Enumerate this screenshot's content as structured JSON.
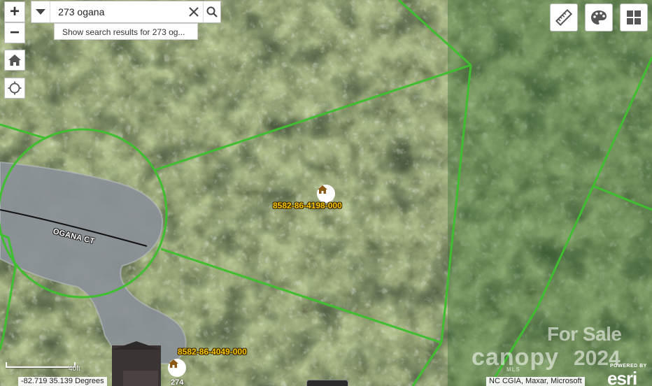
{
  "map": {
    "labels": {
      "parcel_main": "8582-86-4198-000",
      "parcel_south": "8582-86-4049-000",
      "house_number": "274",
      "street": "OGANA CT"
    },
    "colors": {
      "parcel_boundary": "#3fbf2f",
      "road_line": "#111111",
      "parcel_label": "#f6c400"
    }
  },
  "controls": {
    "zoom_in": "+",
    "zoom_out": "−",
    "home_icon": "home-icon",
    "locate_icon": "locate-icon"
  },
  "search": {
    "value": "273 ogana",
    "suggestion": "Show search results for 273 og..."
  },
  "tools": {
    "measure_icon": "ruler-icon",
    "palette_icon": "palette-icon",
    "basemap_icon": "basemap-gallery-icon"
  },
  "watermark": {
    "for_sale": "For Sale",
    "brand": "canopy",
    "mls": "MLS",
    "year": "2024"
  },
  "status": {
    "scale_label": "40ft",
    "coordinates": "-82.719 35.139 Degrees",
    "attribution": "NC CGIA, Maxar, Microsoft",
    "powered_by": "POWERED BY",
    "esri": "esri"
  }
}
